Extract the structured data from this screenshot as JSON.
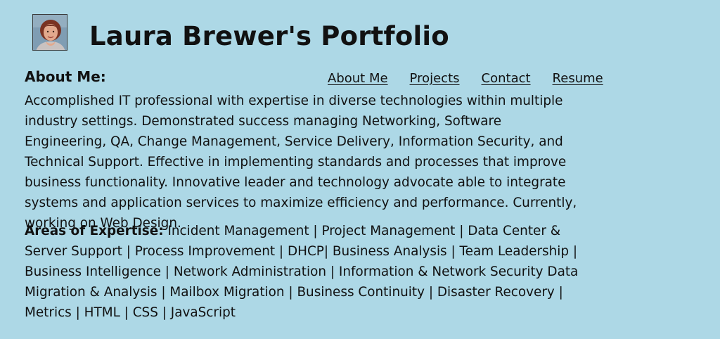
{
  "header": {
    "title": "Laura Brewer's Portfolio",
    "avatar_icon": "person-photo"
  },
  "nav": {
    "items": [
      {
        "label": "About Me"
      },
      {
        "label": "Projects"
      },
      {
        "label": "Contact"
      },
      {
        "label": "Resume"
      }
    ]
  },
  "about": {
    "heading": "About Me:",
    "text": "Accomplished IT professional with expertise in diverse technologies within multiple industry settings. Demonstrated success managing Networking, Software Engineering, QA, Change Management, Service Delivery, Information Security, and Technical Support. Effective in implementing standards and processes that improve business functionality. Innovative leader and technology advocate able to integrate systems and application services to maximize efficiency and performance. Currently, working on Web Design."
  },
  "expertise": {
    "label": "Areas of Expertise:",
    "text": "Incident Management | Project Management | Data Center & Server Support | Process Improvement | DHCP| Business Analysis | Team Leadership | Business Intelligence | Network Administration | Information & Network Security Data Migration & Analysis | Mailbox Migration | Business Continuity | Disaster Recovery | Metrics | HTML | CSS | JavaScript"
  },
  "colors": {
    "background": "#add8e6",
    "text": "#111111"
  }
}
